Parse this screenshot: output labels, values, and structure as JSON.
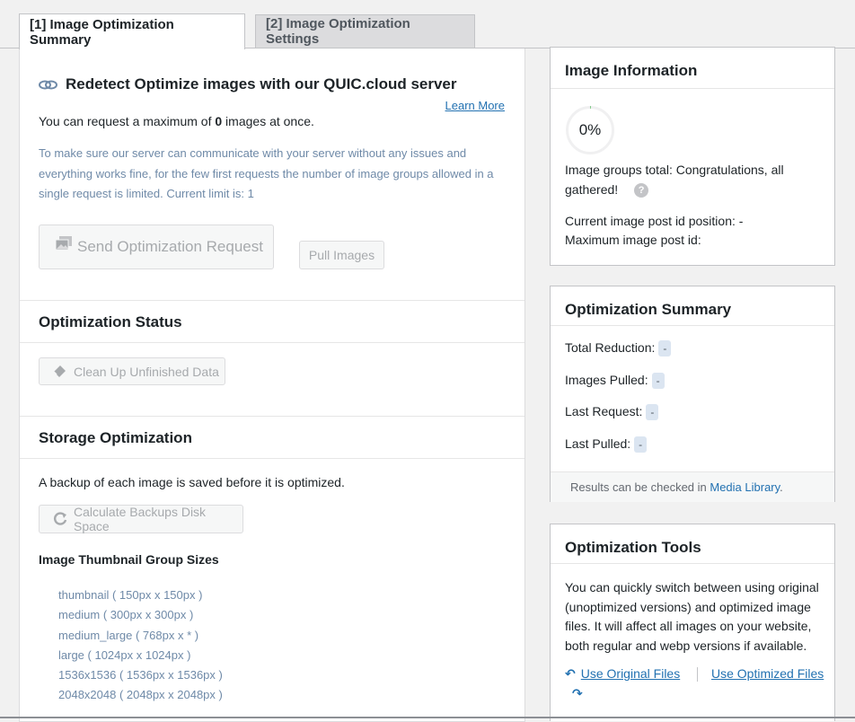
{
  "tabs": [
    {
      "label": "[1] Image Optimization Summary",
      "active": true
    },
    {
      "label": "[2] Image Optimization Settings",
      "active": false
    }
  ],
  "redetect": {
    "title": "Redetect Optimize images with our QUIC.cloud server",
    "learn_more": "Learn More",
    "max_prefix": "You can request a maximum of ",
    "max_value": "0",
    "max_suffix": " images at once.",
    "notice": "To make sure our server can communicate with your server without any issues and everything works fine, for the few first requests the number of image groups allowed in a single request is limited. Current limit is: 1",
    "send_button": "Send Optimization Request",
    "pull_button": "Pull Images"
  },
  "status": {
    "title": "Optimization Status",
    "cleanup_button": "Clean Up Unfinished Data"
  },
  "storage": {
    "title": "Storage Optimization",
    "backup_note": "A backup of each image is saved before it is optimized.",
    "calc_button": "Calculate Backups Disk Space",
    "sizes_title": "Image Thumbnail Group Sizes",
    "sizes": [
      "thumbnail ( 150px x 150px )",
      "medium ( 300px x 300px )",
      "medium_large ( 768px x * )",
      "large ( 1024px x 1024px )",
      "1536x1536 ( 1536px x 1536px )",
      "2048x2048 ( 2048px x 2048px )"
    ]
  },
  "image_info": {
    "title": "Image Information",
    "percent": "0%",
    "groups_total": "Image groups total: Congratulations, all gathered!",
    "current_pos": "Current image post id position: -",
    "max_pos": "Maximum image post id:"
  },
  "summary": {
    "title": "Optimization Summary",
    "rows": [
      {
        "label": "Total Reduction:",
        "value": "-"
      },
      {
        "label": "Images Pulled:",
        "value": "-"
      },
      {
        "label": "Last Request:",
        "value": "-"
      },
      {
        "label": "Last Pulled:",
        "value": "-"
      }
    ],
    "footer_prefix": "Results can be checked in ",
    "footer_link": "Media Library",
    "footer_suffix": "."
  },
  "tools": {
    "title": "Optimization Tools",
    "desc": "You can quickly switch between using original (unoptimized versions) and optimized image files. It will affect all images on your website, both regular and webp versions if available.",
    "use_original": "Use Original Files",
    "use_optimized": "Use Optimized Files"
  },
  "colors": {
    "accent": "#2271b1",
    "progress": "#46b450",
    "disabled_text": "#a7aaad"
  },
  "progress_value": 0
}
